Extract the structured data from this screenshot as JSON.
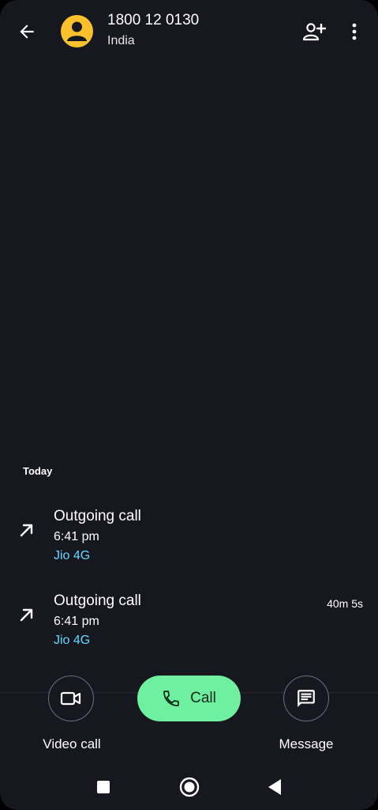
{
  "header": {
    "phone_number": "1800 12 0130",
    "location": "India",
    "back_icon": "arrow-left-icon",
    "add_contact_icon": "person-add-icon",
    "more_icon": "more-vert-icon",
    "avatar_color": "#fbc02d"
  },
  "history": {
    "section_label": "Today",
    "calls": [
      {
        "type": "Outgoing call",
        "time": "6:41 pm",
        "sim": "Jio 4G",
        "duration": ""
      },
      {
        "type": "Outgoing call",
        "time": "6:41 pm",
        "sim": "Jio 4G",
        "duration": "40m 5s"
      }
    ],
    "sim_color": "#64d8ff"
  },
  "actions": {
    "video_call_label": "Video call",
    "call_label": "Call",
    "message_label": "Message",
    "call_color": "#6ff0a0"
  },
  "colors": {
    "background": "#16171f"
  }
}
